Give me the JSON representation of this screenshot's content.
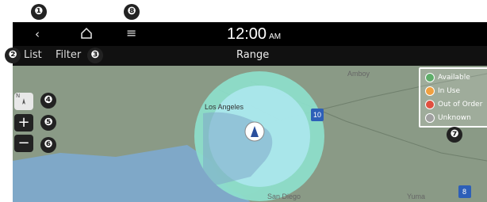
{
  "callouts": [
    "❶",
    "❷",
    "❸",
    "❹",
    "❺",
    "❻",
    "❼",
    "❽"
  ],
  "status": {
    "back_icon": "‹",
    "menu_icon": "≡",
    "time": "12:00",
    "ampm": "AM"
  },
  "toolbar": {
    "list_label": "List",
    "filter_label": "Filter",
    "title": "Range"
  },
  "map": {
    "city_la": "Los Angeles",
    "city_amboy": "Amboy",
    "city_sandiego": "San Diego",
    "city_yuma": "Yuma",
    "shield_10": "10",
    "shield_8": "8"
  },
  "controls": {
    "compass_label": "N",
    "zoom_in": "+",
    "zoom_out": "−"
  },
  "legend": {
    "items": [
      {
        "label": "Available",
        "color": "#5fae6a"
      },
      {
        "label": "In Use",
        "color": "#f0a040"
      },
      {
        "label": "Out of Order",
        "color": "#e05040"
      },
      {
        "label": "Unknown",
        "color": "#a0a0a0"
      }
    ]
  },
  "colors": {
    "land": "#8a9a86",
    "water": "#7fa8c8",
    "range_outer": "#8de0cc",
    "range_inner": "#aee8f0"
  }
}
